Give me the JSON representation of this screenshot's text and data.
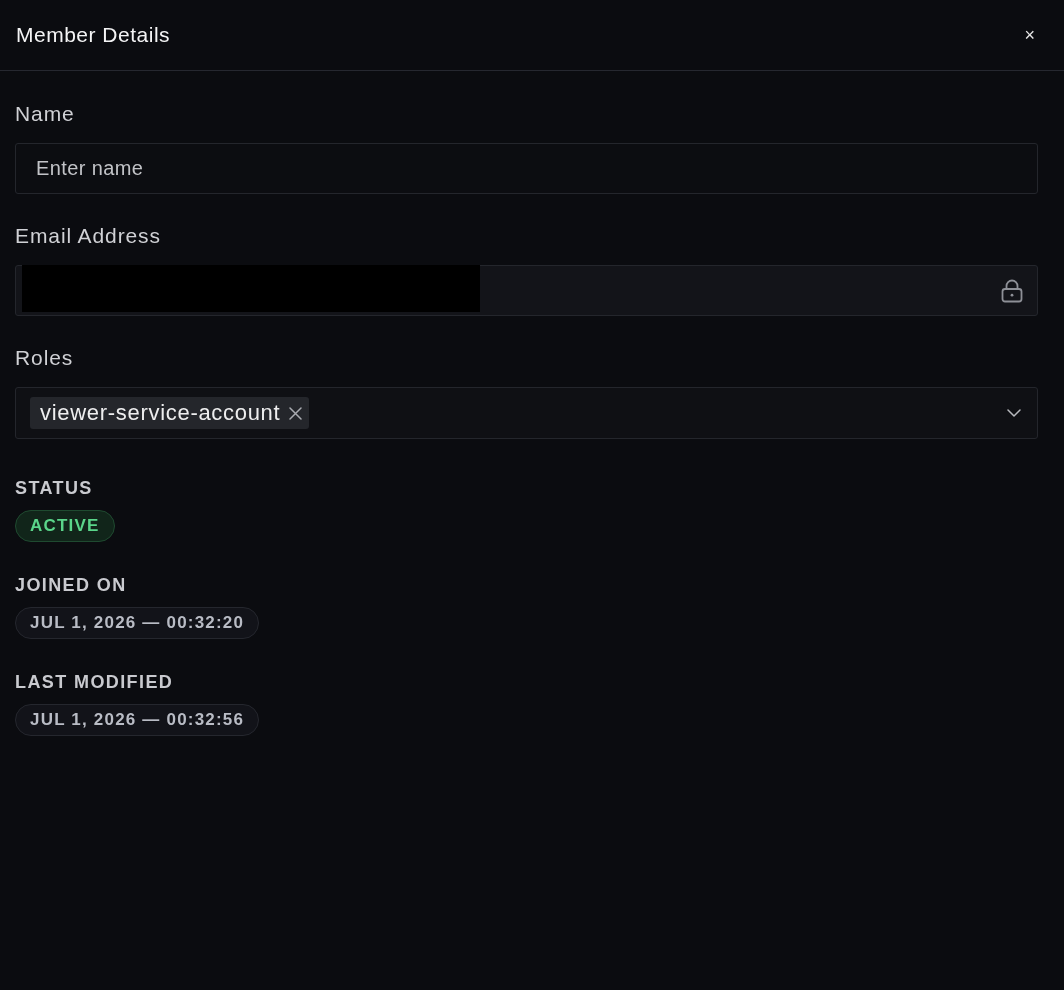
{
  "panel": {
    "title": "Member Details",
    "close": "×"
  },
  "fields": [
    {
      "kind": "text",
      "label": "Name",
      "placeholder": "Enter name"
    },
    {
      "kind": "email",
      "label": "Email Address",
      "redacted": true,
      "locked": true
    },
    {
      "kind": "roles",
      "label": "Roles",
      "roles": [
        {
          "label": "viewer-service-account"
        }
      ]
    }
  ],
  "status": {
    "label": "STATUS",
    "value": "ACTIVE",
    "kind": "active"
  },
  "dates": [
    {
      "label": "JOINED ON",
      "value": "JUL 1, 2026 — 00:32:20"
    },
    {
      "label": "LAST MODIFIED",
      "value": "JUL 1, 2026 — 00:32:56"
    }
  ]
}
